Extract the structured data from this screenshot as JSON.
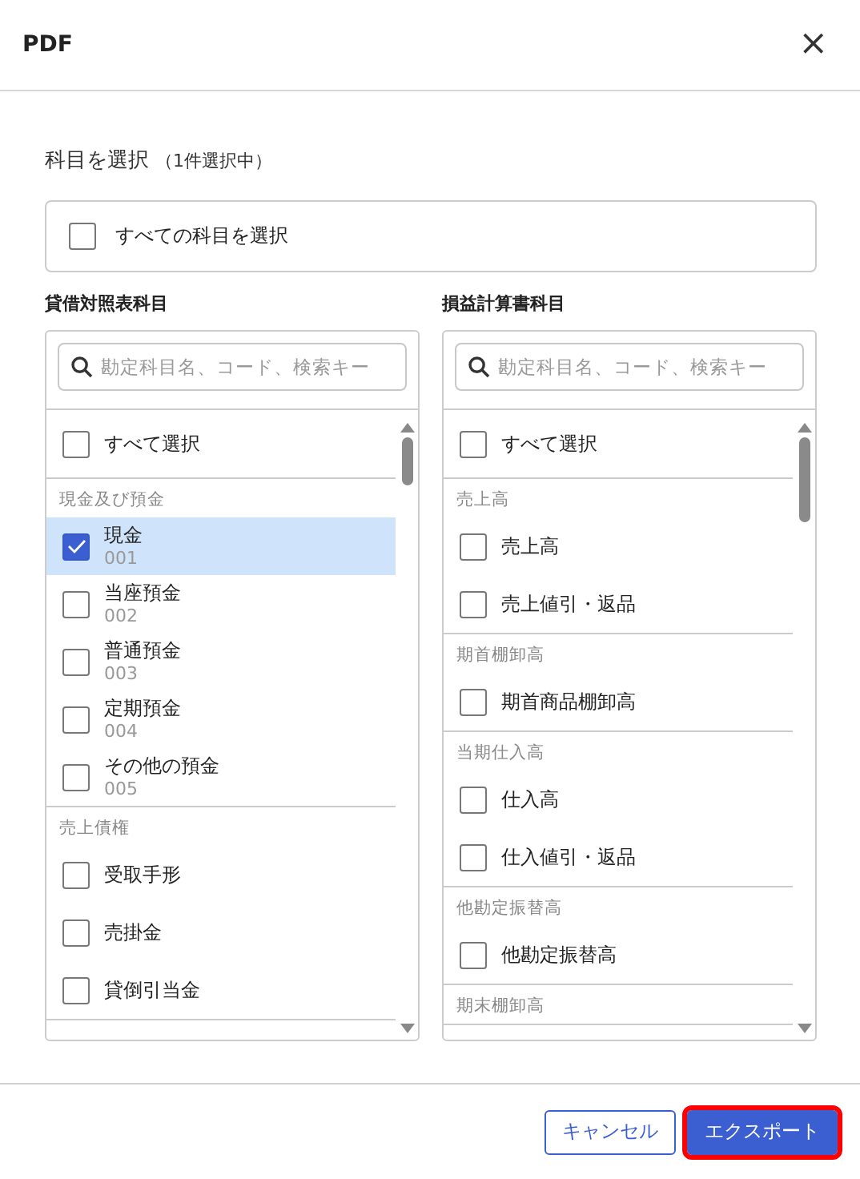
{
  "dialog": {
    "title": "PDF",
    "close": "×"
  },
  "heading": {
    "title": "科目を選択",
    "count": "（1件選択中）"
  },
  "select_all": {
    "label": "すべての科目を選択",
    "checked": false
  },
  "panels": [
    {
      "title": "貸借対照表科目",
      "search": {
        "placeholder": "勘定科目名、コード、検索キー"
      },
      "select_all": {
        "label": "すべて選択",
        "checked": false
      },
      "groups": [
        {
          "label": "現金及び預金",
          "items": [
            {
              "name": "現金",
              "code": "001",
              "checked": true,
              "selected": true
            },
            {
              "name": "当座預金",
              "code": "002",
              "checked": false,
              "selected": false
            },
            {
              "name": "普通預金",
              "code": "003",
              "checked": false,
              "selected": false
            },
            {
              "name": "定期預金",
              "code": "004",
              "checked": false,
              "selected": false
            },
            {
              "name": "その他の預金",
              "code": "005",
              "checked": false,
              "selected": false
            }
          ]
        },
        {
          "label": "売上債権",
          "items": [
            {
              "name": "受取手形",
              "checked": false,
              "selected": false
            },
            {
              "name": "売掛金",
              "checked": false,
              "selected": false
            },
            {
              "name": "貸倒引当金",
              "checked": false,
              "selected": false
            }
          ]
        }
      ]
    },
    {
      "title": "損益計算書科目",
      "search": {
        "placeholder": "勘定科目名、コード、検索キー"
      },
      "select_all": {
        "label": "すべて選択",
        "checked": false
      },
      "groups": [
        {
          "label": "売上高",
          "items": [
            {
              "name": "売上高",
              "checked": false,
              "selected": false
            },
            {
              "name": "売上値引・返品",
              "checked": false,
              "selected": false
            }
          ]
        },
        {
          "label": "期首棚卸高",
          "items": [
            {
              "name": "期首商品棚卸高",
              "checked": false,
              "selected": false
            }
          ]
        },
        {
          "label": "当期仕入高",
          "items": [
            {
              "name": "仕入高",
              "checked": false,
              "selected": false
            },
            {
              "name": "仕入値引・返品",
              "checked": false,
              "selected": false
            }
          ]
        },
        {
          "label": "他勘定振替高",
          "items": [
            {
              "name": "他勘定振替高",
              "checked": false,
              "selected": false
            }
          ]
        },
        {
          "label": "期末棚卸高"
        }
      ]
    }
  ],
  "buttons": [
    {
      "label": "キャンセル",
      "kind": "secondary",
      "highlighted": false
    },
    {
      "label": "エクスポート",
      "kind": "primary",
      "highlighted": true
    }
  ]
}
